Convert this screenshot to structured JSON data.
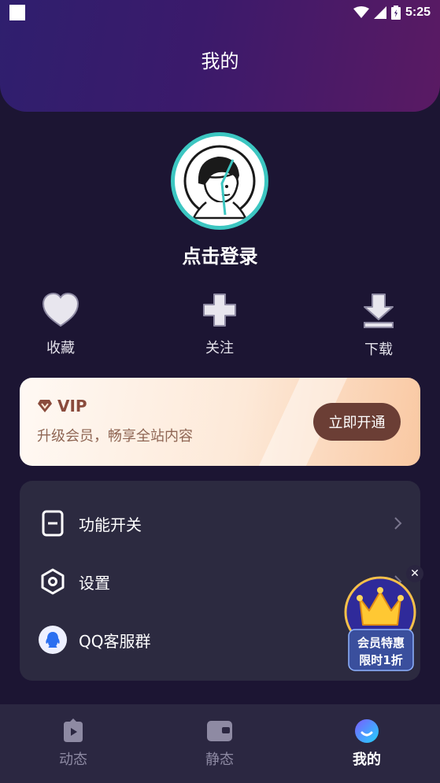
{
  "status_bar": {
    "time": "5:25"
  },
  "header": {
    "title": "我的"
  },
  "profile": {
    "login_text": "点击登录"
  },
  "quick_actions": [
    {
      "label": "收藏",
      "icon": "heart-icon"
    },
    {
      "label": "关注",
      "icon": "plus-icon"
    },
    {
      "label": "下载",
      "icon": "download-icon"
    }
  ],
  "vip": {
    "badge": "VIP",
    "subtitle": "升级会员，畅享全站内容",
    "button_label": "立即开通"
  },
  "menu": [
    {
      "label": "功能开关",
      "icon": "toggle-icon"
    },
    {
      "label": "设置",
      "icon": "settings-icon"
    },
    {
      "label": "QQ客服群",
      "icon": "qq-icon"
    }
  ],
  "promo": {
    "line1": "会员特惠",
    "line2": "限时1折",
    "close": "✕"
  },
  "tabs": [
    {
      "label": "动态",
      "icon": "video-icon",
      "active": false
    },
    {
      "label": "静态",
      "icon": "wallet-icon",
      "active": false
    },
    {
      "label": "我的",
      "icon": "profile-icon",
      "active": true
    }
  ],
  "colors": {
    "background": "#1c1533",
    "accent_teal": "#3cc6c1",
    "vip_button": "#6b3e35",
    "card": "#2c2a40"
  }
}
